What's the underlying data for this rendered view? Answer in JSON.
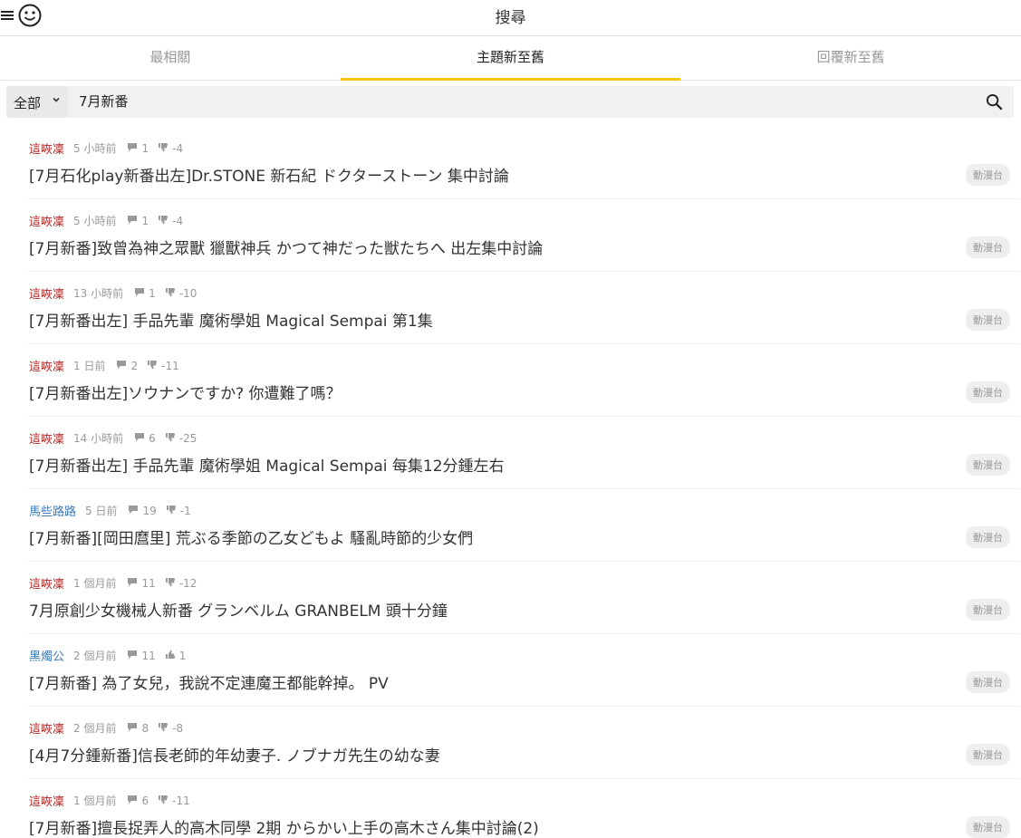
{
  "header": {
    "title": "搜尋"
  },
  "tabs": [
    {
      "label": "最相關",
      "active": false
    },
    {
      "label": "主題新至舊",
      "active": true
    },
    {
      "label": "回覆新至舊",
      "active": false
    }
  ],
  "search": {
    "scope": "全部",
    "query": "7月新番"
  },
  "colors": {
    "accent": "#f5c518",
    "author_red": "#b71c1c",
    "author_blue": "#3b7ab8"
  },
  "results": [
    {
      "author": "這咴凜",
      "author_color": "red",
      "time": "5 小時前",
      "replies": "1",
      "rating": "-4",
      "rating_type": "down",
      "title": "[7月石化play新番出左]Dr.STONE 新石紀 ドクターストーン 集中討論",
      "tag": "動漫台"
    },
    {
      "author": "這咴凜",
      "author_color": "red",
      "time": "5 小時前",
      "replies": "1",
      "rating": "-4",
      "rating_type": "down",
      "title": "[7月新番]致曾為神之眾獸 獵獸神兵 かつて神だった獣たちへ 出左集中討論",
      "tag": "動漫台"
    },
    {
      "author": "這咴凜",
      "author_color": "red",
      "time": "13 小時前",
      "replies": "1",
      "rating": "-10",
      "rating_type": "down",
      "title": "[7月新番出左] 手品先輩 魔術學姐 Magical Sempai 第1集",
      "tag": "動漫台"
    },
    {
      "author": "這咴凜",
      "author_color": "red",
      "time": "1 日前",
      "replies": "2",
      "rating": "-11",
      "rating_type": "down",
      "title": "[7月新番出左]ソウナンですか? 你遭難了嗎？",
      "tag": "動漫台"
    },
    {
      "author": "這咴凜",
      "author_color": "red",
      "time": "14 小時前",
      "replies": "6",
      "rating": "-25",
      "rating_type": "down",
      "title": "[7月新番出左] 手品先輩 魔術學姐 Magical Sempai 每集12分鍾左右",
      "tag": "動漫台"
    },
    {
      "author": "馬些路路",
      "author_color": "blue",
      "time": "5 日前",
      "replies": "19",
      "rating": "-1",
      "rating_type": "down",
      "title": "[7月新番][岡田麿里] 荒ぶる季節の乙女どもよ 騷亂時節的少女們",
      "tag": "動漫台"
    },
    {
      "author": "這咴凜",
      "author_color": "red",
      "time": "1 個月前",
      "replies": "11",
      "rating": "-12",
      "rating_type": "down",
      "title": "7月原創少女機械人新番 グランベルム GRANBELM 頭十分鐘",
      "tag": "動漫台"
    },
    {
      "author": "黑燭公",
      "author_color": "blue",
      "time": "2 個月前",
      "replies": "11",
      "rating": "1",
      "rating_type": "up",
      "title": "[7月新番] 為了女兒，我說不定連魔王都能幹掉。 PV",
      "tag": "動漫台"
    },
    {
      "author": "這咴凜",
      "author_color": "red",
      "time": "2 個月前",
      "replies": "8",
      "rating": "-8",
      "rating_type": "down",
      "title": "[4月7分鍾新番]信長老師的年幼妻子. ノブナガ先生の幼な妻",
      "tag": "動漫台"
    },
    {
      "author": "這咴凜",
      "author_color": "red",
      "time": "1 個月前",
      "replies": "6",
      "rating": "-11",
      "rating_type": "down",
      "title": "[7月新番]擅長捉弄人的高木同學 2期 からかい上手の高木さん集中討論(2)",
      "tag": "動漫台"
    }
  ]
}
